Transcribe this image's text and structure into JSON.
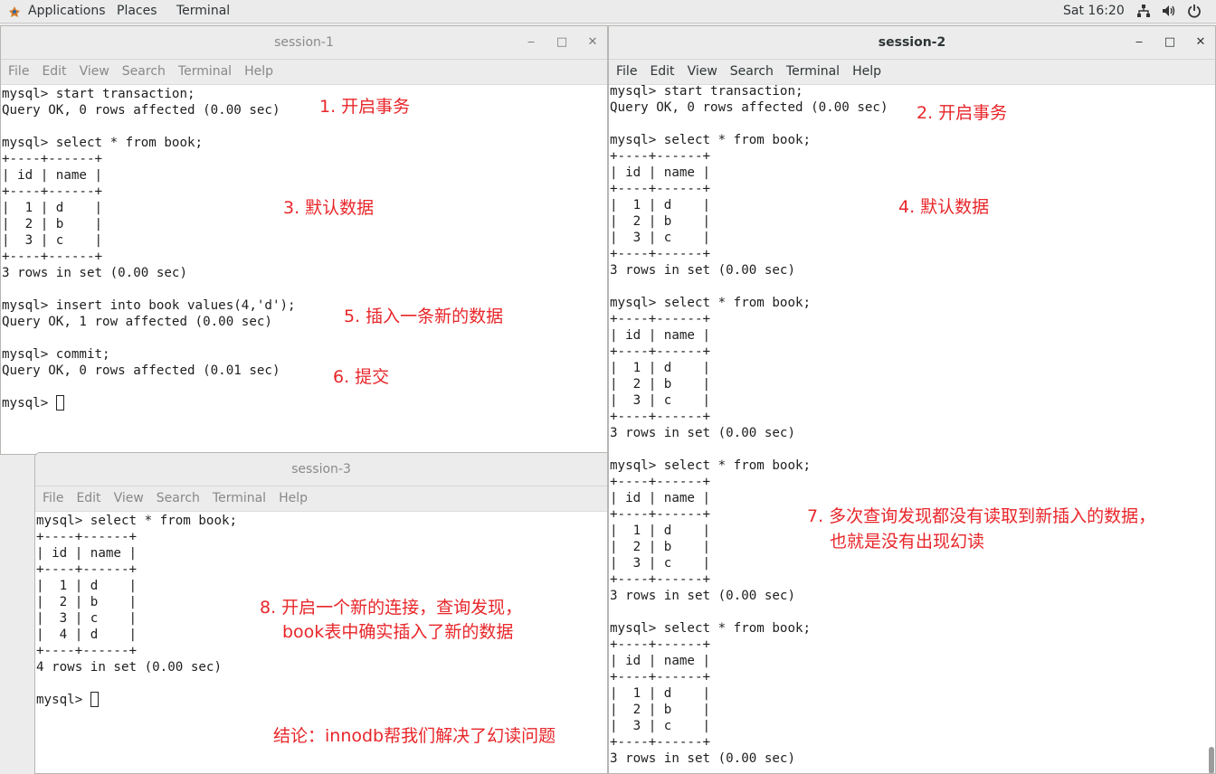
{
  "topbar": {
    "applications": "Applications",
    "places": "Places",
    "terminal": "Terminal",
    "clock": "Sat 16:20",
    "icons": [
      "network-icon",
      "volume-icon",
      "power-icon"
    ]
  },
  "menu": {
    "file": "File",
    "edit": "Edit",
    "view": "View",
    "search": "Search",
    "terminal": "Terminal",
    "help": "Help"
  },
  "session1": {
    "title": "session-1",
    "lines": [
      "mysql> start transaction;",
      "Query OK, 0 rows affected (0.00 sec)",
      "",
      "mysql> select * from book;",
      "+----+------+",
      "| id | name |",
      "+----+------+",
      "|  1 | d    |",
      "|  2 | b    |",
      "|  3 | c    |",
      "+----+------+",
      "3 rows in set (0.00 sec)",
      "",
      "mysql> insert into book values(4,'d');",
      "Query OK, 1 row affected (0.00 sec)",
      "",
      "mysql> commit;",
      "Query OK, 0 rows affected (0.01 sec)",
      ""
    ],
    "prompt": "mysql> "
  },
  "session2": {
    "title": "session-2",
    "lines": [
      "mysql> start transaction;",
      "Query OK, 0 rows affected (0.00 sec)",
      "",
      "mysql> select * from book;",
      "+----+------+",
      "| id | name |",
      "+----+------+",
      "|  1 | d    |",
      "|  2 | b    |",
      "|  3 | c    |",
      "+----+------+",
      "3 rows in set (0.00 sec)",
      "",
      "mysql> select * from book;",
      "+----+------+",
      "| id | name |",
      "+----+------+",
      "|  1 | d    |",
      "|  2 | b    |",
      "|  3 | c    |",
      "+----+------+",
      "3 rows in set (0.00 sec)",
      "",
      "mysql> select * from book;",
      "+----+------+",
      "| id | name |",
      "+----+------+",
      "|  1 | d    |",
      "|  2 | b    |",
      "|  3 | c    |",
      "+----+------+",
      "3 rows in set (0.00 sec)",
      "",
      "mysql> select * from book;",
      "+----+------+",
      "| id | name |",
      "+----+------+",
      "|  1 | d    |",
      "|  2 | b    |",
      "|  3 | c    |",
      "+----+------+",
      "3 rows in set (0.00 sec)"
    ]
  },
  "session3": {
    "title": "session-3",
    "lines": [
      "mysql> select * from book;",
      "+----+------+",
      "| id | name |",
      "+----+------+",
      "|  1 | d    |",
      "|  2 | b    |",
      "|  3 | c    |",
      "|  4 | d    |",
      "+----+------+",
      "4 rows in set (0.00 sec)",
      ""
    ],
    "prompt": "mysql> "
  },
  "annotations": {
    "a1": "1. 开启事务",
    "a2": "2. 开启事务",
    "a3": "3. 默认数据",
    "a4": "4. 默认数据",
    "a5": "5. 插入一条新的数据",
    "a6": "6. 提交",
    "a7_line1": "7. 多次查询发现都没有读取到新插入的数据，",
    "a7_line2": "也就是没有出现幻读",
    "a8_line1": "8. 开启一个新的连接，查询发现，",
    "a8_line2": "book表中确实插入了新的数据",
    "conclusion": "结论：innodb帮我们解决了幻读问题"
  },
  "colors": {
    "annotation": "#e8262a",
    "terminal_bg": "#ffffff",
    "chrome_bg": "#ececec"
  }
}
